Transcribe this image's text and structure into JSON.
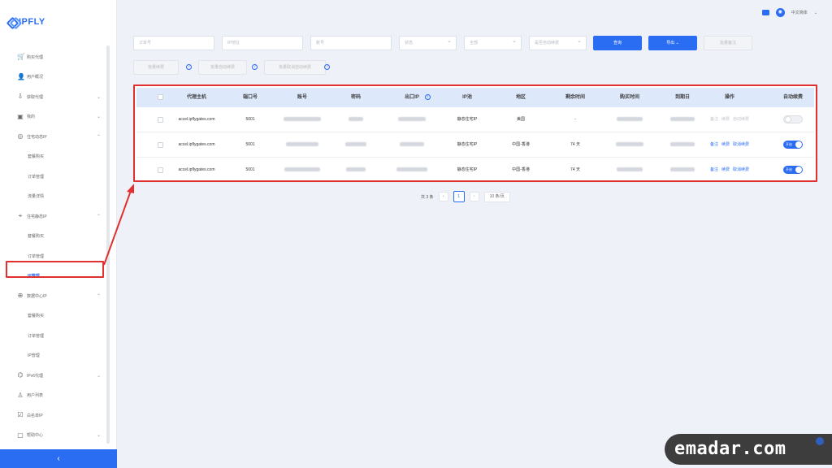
{
  "brand": {
    "name": "IPFLY"
  },
  "topbar": {
    "language": "中文简体"
  },
  "sidebar": {
    "items": [
      {
        "label": "购买代理",
        "icon": "cart-icon",
        "sub": false,
        "chevron": ""
      },
      {
        "label": "用户概况",
        "icon": "user-icon",
        "sub": false,
        "chevron": ""
      },
      {
        "label": "获取代理",
        "icon": "download-icon",
        "sub": false,
        "chevron": "⌄"
      },
      {
        "label": "我的",
        "icon": "wallet-icon",
        "sub": false,
        "chevron": "⌄"
      },
      {
        "label": "住宅动态IP",
        "icon": "globe-icon",
        "sub": false,
        "chevron": "⌃"
      },
      {
        "label": "套餐购买",
        "icon": "",
        "sub": true,
        "chevron": ""
      },
      {
        "label": "订单管理",
        "icon": "",
        "sub": true,
        "chevron": ""
      },
      {
        "label": "流量详情",
        "icon": "",
        "sub": true,
        "chevron": ""
      },
      {
        "label": "住宅静态IP",
        "icon": "pin-icon",
        "sub": false,
        "chevron": "⌃"
      },
      {
        "label": "套餐购买",
        "icon": "",
        "sub": true,
        "chevron": ""
      },
      {
        "label": "订单管理",
        "icon": "",
        "sub": true,
        "chevron": ""
      },
      {
        "label": "IP管理",
        "icon": "",
        "sub": true,
        "chevron": "",
        "active": true
      },
      {
        "label": "数据中心IP",
        "icon": "server-icon",
        "sub": false,
        "chevron": "⌃"
      },
      {
        "label": "套餐购买",
        "icon": "",
        "sub": true,
        "chevron": ""
      },
      {
        "label": "订单管理",
        "icon": "",
        "sub": true,
        "chevron": ""
      },
      {
        "label": "IP管理",
        "icon": "",
        "sub": true,
        "chevron": ""
      },
      {
        "label": "IPv6代理",
        "icon": "network-icon",
        "sub": false,
        "chevron": "⌄"
      },
      {
        "label": "用户列表",
        "icon": "users-icon",
        "sub": false,
        "chevron": ""
      },
      {
        "label": "白名单IP",
        "icon": "list-icon",
        "sub": false,
        "chevron": ""
      },
      {
        "label": "帮助中心",
        "icon": "help-icon",
        "sub": false,
        "chevron": "⌄"
      }
    ],
    "collapse_label": "‹"
  },
  "filters": {
    "order_no_placeholder": "订单号",
    "ip_placeholder": "IP地址",
    "account_placeholder": "账号",
    "status_placeholder": "状态",
    "region_placeholder": "全部",
    "renew_placeholder": "是否自动续费",
    "search_label": "查询",
    "export_label": "导出 ⌄",
    "batch_remark_label": "批量备注",
    "batch_renew_label": "批量续费",
    "batch_auto_label": "批量自动续费",
    "batch_cancel_auto_label": "批量取消自动续费"
  },
  "table": {
    "columns": [
      "代理主机",
      "端口号",
      "账号",
      "密码",
      "出口IP",
      "IP池",
      "地区",
      "剩余时间",
      "购买时间",
      "到期日",
      "操作",
      "自动续费"
    ],
    "rows": [
      {
        "host": "accel.ipflygates.com",
        "port": "5001",
        "pool": "静态住宅IP",
        "region": "美国",
        "remaining": "-",
        "actions": [
          "备注",
          "续费",
          "自动续费"
        ],
        "actions_enabled": false,
        "auto_renew": false,
        "toggle_text": ""
      },
      {
        "host": "accel.ipflygates.com",
        "port": "5001",
        "pool": "静态住宅IP",
        "region": "中国-香港",
        "remaining": "74 天",
        "actions": [
          "备注",
          "续费",
          "取消续费"
        ],
        "actions_enabled": true,
        "auto_renew": true,
        "toggle_text": "开启"
      },
      {
        "host": "accel.ipflygates.com",
        "port": "5001",
        "pool": "静态住宅IP",
        "region": "中国-香港",
        "remaining": "74 天",
        "actions": [
          "备注",
          "续费",
          "取消续费"
        ],
        "actions_enabled": true,
        "auto_renew": true,
        "toggle_text": "开启"
      }
    ]
  },
  "pagination": {
    "total": "共 3 条",
    "prev": "‹",
    "current": "1",
    "next": "›",
    "page_size": "10 条/页"
  },
  "watermark": {
    "text": "emadar.com"
  },
  "colors": {
    "accent": "#2b6df2",
    "highlight": "#e03030",
    "header_bg": "#dde8fb"
  }
}
